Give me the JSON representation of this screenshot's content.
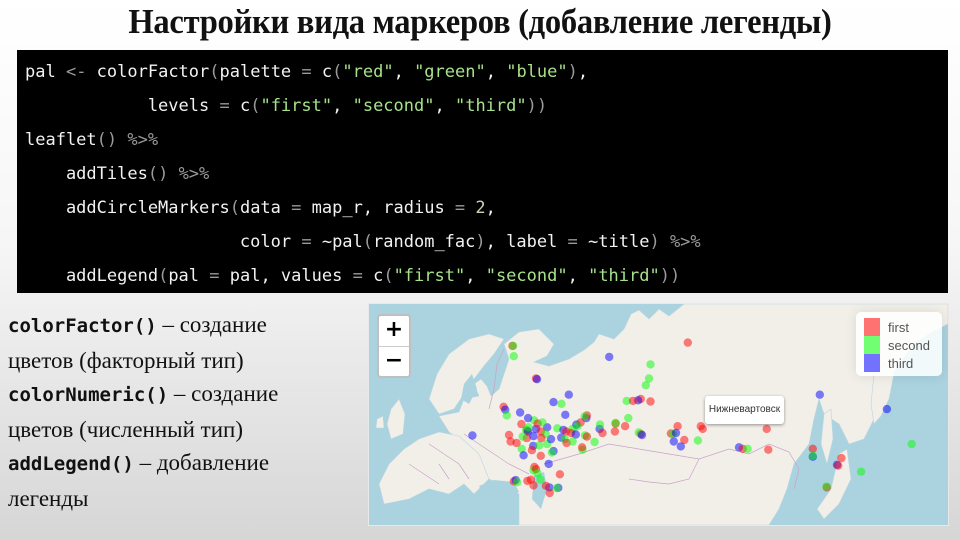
{
  "slide": {
    "title": "Настройки вида маркеров (добавление легенды)"
  },
  "code": {
    "lines": [
      [
        {
          "t": "pal ",
          "c": "plain"
        },
        {
          "t": "<-",
          "c": "op"
        },
        {
          "t": " colorFactor",
          "c": "plain"
        },
        {
          "t": "(",
          "c": "op"
        },
        {
          "t": "palette ",
          "c": "plain"
        },
        {
          "t": "=",
          "c": "op"
        },
        {
          "t": " c",
          "c": "plain"
        },
        {
          "t": "(",
          "c": "op"
        },
        {
          "t": "\"red\"",
          "c": "str"
        },
        {
          "t": ", ",
          "c": "plain"
        },
        {
          "t": "\"green\"",
          "c": "str"
        },
        {
          "t": ", ",
          "c": "plain"
        },
        {
          "t": "\"blue\"",
          "c": "str"
        },
        {
          "t": ")",
          "c": "op"
        },
        {
          "t": ",",
          "c": "plain"
        }
      ],
      [
        {
          "t": "            levels ",
          "c": "plain"
        },
        {
          "t": "=",
          "c": "op"
        },
        {
          "t": " c",
          "c": "plain"
        },
        {
          "t": "(",
          "c": "op"
        },
        {
          "t": "\"first\"",
          "c": "str"
        },
        {
          "t": ", ",
          "c": "plain"
        },
        {
          "t": "\"second\"",
          "c": "str"
        },
        {
          "t": ", ",
          "c": "plain"
        },
        {
          "t": "\"third\"",
          "c": "str"
        },
        {
          "t": "))",
          "c": "op"
        }
      ],
      [
        {
          "t": "leaflet",
          "c": "plain"
        },
        {
          "t": "()",
          "c": "op"
        },
        {
          "t": " ",
          "c": "plain"
        },
        {
          "t": "%>%",
          "c": "op"
        }
      ],
      [
        {
          "t": "    addTiles",
          "c": "plain"
        },
        {
          "t": "()",
          "c": "op"
        },
        {
          "t": " ",
          "c": "plain"
        },
        {
          "t": "%>%",
          "c": "op"
        }
      ],
      [
        {
          "t": "    addCircleMarkers",
          "c": "plain"
        },
        {
          "t": "(",
          "c": "op"
        },
        {
          "t": "data ",
          "c": "plain"
        },
        {
          "t": "=",
          "c": "op"
        },
        {
          "t": " map_r, radius ",
          "c": "plain"
        },
        {
          "t": "=",
          "c": "op"
        },
        {
          "t": " ",
          "c": "plain"
        },
        {
          "t": "2",
          "c": "num"
        },
        {
          "t": ",",
          "c": "plain"
        }
      ],
      [
        {
          "t": "                     color ",
          "c": "plain"
        },
        {
          "t": "=",
          "c": "op"
        },
        {
          "t": " ~pal",
          "c": "plain"
        },
        {
          "t": "(",
          "c": "op"
        },
        {
          "t": "random_fac",
          "c": "plain"
        },
        {
          "t": ")",
          "c": "op"
        },
        {
          "t": ", label ",
          "c": "plain"
        },
        {
          "t": "=",
          "c": "op"
        },
        {
          "t": " ~title",
          "c": "plain"
        },
        {
          "t": ")",
          "c": "op"
        },
        {
          "t": " ",
          "c": "plain"
        },
        {
          "t": "%>%",
          "c": "op"
        }
      ],
      [
        {
          "t": "    addLegend",
          "c": "plain"
        },
        {
          "t": "(",
          "c": "op"
        },
        {
          "t": "pal ",
          "c": "plain"
        },
        {
          "t": "=",
          "c": "op"
        },
        {
          "t": " pal, values ",
          "c": "plain"
        },
        {
          "t": "=",
          "c": "op"
        },
        {
          "t": " c",
          "c": "plain"
        },
        {
          "t": "(",
          "c": "op"
        },
        {
          "t": "\"first\"",
          "c": "str"
        },
        {
          "t": ", ",
          "c": "plain"
        },
        {
          "t": "\"second\"",
          "c": "str"
        },
        {
          "t": ", ",
          "c": "plain"
        },
        {
          "t": "\"third\"",
          "c": "str"
        },
        {
          "t": "))",
          "c": "op"
        }
      ]
    ]
  },
  "notes": [
    {
      "fn": "colorFactor()",
      "desc_1": " – создание",
      "desc_2": "цветов (факторный тип)"
    },
    {
      "fn": "colorNumeric()",
      "desc_1": " – создание",
      "desc_2": "цветов (численный тип)"
    },
    {
      "fn": "addLegend()",
      "desc_1": " – добавление",
      "desc_2": "легенды"
    }
  ],
  "map": {
    "zoom_in_label": "+",
    "zoom_out_label": "−",
    "tooltip_label": "Нижневартовск",
    "legend": [
      {
        "label": "first",
        "color": "#ff0000"
      },
      {
        "label": "second",
        "color": "#00ff00"
      },
      {
        "label": "third",
        "color": "#0000ff"
      }
    ],
    "colors": {
      "water": "#aad3df",
      "land": "#f2efe9",
      "border": "#c7a3c7"
    },
    "markers": [
      {
        "lat": 68.9,
        "lon": 33.1,
        "g": "first"
      },
      {
        "lat": 68.9,
        "lon": 33.3,
        "g": "second"
      },
      {
        "lat": 67.6,
        "lon": 33.5,
        "g": "second"
      },
      {
        "lat": 64.5,
        "lon": 40.5,
        "g": "first"
      },
      {
        "lat": 64.4,
        "lon": 40.8,
        "g": "third"
      },
      {
        "lat": 69.3,
        "lon": 88.2,
        "g": "first"
      },
      {
        "lat": 67.5,
        "lon": 63.5,
        "g": "third"
      },
      {
        "lat": 66.5,
        "lon": 76.5,
        "g": "second"
      },
      {
        "lat": 64.5,
        "lon": 76.0,
        "g": "second"
      },
      {
        "lat": 63.5,
        "lon": 75.0,
        "g": "second"
      },
      {
        "lat": 61.0,
        "lon": 69.0,
        "g": "second"
      },
      {
        "lat": 62.0,
        "lon": 50.8,
        "g": "third"
      },
      {
        "lat": 60.0,
        "lon": 30.3,
        "g": "first"
      },
      {
        "lat": 59.5,
        "lon": 30.8,
        "g": "third"
      },
      {
        "lat": 58.5,
        "lon": 31.3,
        "g": "second"
      },
      {
        "lat": 59.0,
        "lon": 35.5,
        "g": "third"
      },
      {
        "lat": 60.8,
        "lon": 46.0,
        "g": "third"
      },
      {
        "lat": 60.5,
        "lon": 48.5,
        "g": "second"
      },
      {
        "lat": 61.3,
        "lon": 73.4,
        "g": "first"
      },
      {
        "lat": 61.1,
        "lon": 72.6,
        "g": "third"
      },
      {
        "lat": 61.0,
        "lon": 71.0,
        "g": "first"
      },
      {
        "lat": 60.9,
        "lon": 76.5,
        "g": "first"
      },
      {
        "lat": 58.0,
        "lon": 56.3,
        "g": "third"
      },
      {
        "lat": 58.5,
        "lon": 56.5,
        "g": "first"
      },
      {
        "lat": 58.3,
        "lon": 55.8,
        "g": "second"
      },
      {
        "lat": 57.0,
        "lon": 65.5,
        "g": "first"
      },
      {
        "lat": 56.5,
        "lon": 68.5,
        "g": "first"
      },
      {
        "lat": 58.0,
        "lon": 69.5,
        "g": "second"
      },
      {
        "lat": 56.0,
        "lon": 60.5,
        "g": "third"
      },
      {
        "lat": 55.0,
        "lon": 73.4,
        "g": "first"
      },
      {
        "lat": 55.3,
        "lon": 72.8,
        "g": "second"
      },
      {
        "lat": 54.8,
        "lon": 73.8,
        "g": "third"
      },
      {
        "lat": 55.1,
        "lon": 82.9,
        "g": "first"
      },
      {
        "lat": 55.0,
        "lon": 83.5,
        "g": "second"
      },
      {
        "lat": 55.2,
        "lon": 84.5,
        "g": "third"
      },
      {
        "lat": 56.5,
        "lon": 85.0,
        "g": "first"
      },
      {
        "lat": 56.0,
        "lon": 92.9,
        "g": "first"
      },
      {
        "lat": 56.5,
        "lon": 92.3,
        "g": "first"
      },
      {
        "lat": 53.5,
        "lon": 83.8,
        "g": "third"
      },
      {
        "lat": 52.5,
        "lon": 86.0,
        "g": "third"
      },
      {
        "lat": 53.8,
        "lon": 87.1,
        "g": "first"
      },
      {
        "lat": 52.3,
        "lon": 104.3,
        "g": "third"
      },
      {
        "lat": 52.0,
        "lon": 105.5,
        "g": "first"
      },
      {
        "lat": 52.0,
        "lon": 107.0,
        "g": "second"
      },
      {
        "lat": 51.8,
        "lon": 113.5,
        "g": "first"
      },
      {
        "lat": 56.0,
        "lon": 113.0,
        "g": "first"
      },
      {
        "lat": 52.0,
        "lon": 127.5,
        "g": "first"
      },
      {
        "lat": 50.3,
        "lon": 127.5,
        "g": "third"
      },
      {
        "lat": 50.5,
        "lon": 127.5,
        "g": "second"
      },
      {
        "lat": 50.0,
        "lon": 136.5,
        "g": "first"
      },
      {
        "lat": 48.5,
        "lon": 135.1,
        "g": "third"
      },
      {
        "lat": 48.3,
        "lon": 135.5,
        "g": "first"
      },
      {
        "lat": 43.1,
        "lon": 131.9,
        "g": "first"
      },
      {
        "lat": 43.3,
        "lon": 131.8,
        "g": "second"
      },
      {
        "lat": 46.9,
        "lon": 142.7,
        "g": "second"
      },
      {
        "lat": 53.0,
        "lon": 158.6,
        "g": "second"
      },
      {
        "lat": 59.6,
        "lon": 150.8,
        "g": "third"
      },
      {
        "lat": 62.0,
        "lon": 129.7,
        "g": "third"
      },
      {
        "lat": 54.7,
        "lon": 20.5,
        "g": "third"
      },
      {
        "lat": 56.3,
        "lon": 44.0,
        "g": "third"
      },
      {
        "lat": 56.0,
        "lon": 40.5,
        "g": "third"
      },
      {
        "lat": 55.7,
        "lon": 37.6,
        "g": "first"
      },
      {
        "lat": 55.8,
        "lon": 37.4,
        "g": "second"
      },
      {
        "lat": 55.5,
        "lon": 38.0,
        "g": "third"
      },
      {
        "lat": 56.1,
        "lon": 47.2,
        "g": "second"
      },
      {
        "lat": 55.8,
        "lon": 49.1,
        "g": "third"
      },
      {
        "lat": 55.5,
        "lon": 50.0,
        "g": "first"
      },
      {
        "lat": 56.0,
        "lon": 52.0,
        "g": "second"
      },
      {
        "lat": 54.7,
        "lon": 55.9,
        "g": "second"
      },
      {
        "lat": 54.5,
        "lon": 56.5,
        "g": "first"
      },
      {
        "lat": 54.3,
        "lon": 48.4,
        "g": "third"
      },
      {
        "lat": 54.0,
        "lon": 49.5,
        "g": "second"
      },
      {
        "lat": 53.2,
        "lon": 50.1,
        "g": "first"
      },
      {
        "lat": 53.4,
        "lon": 58.9,
        "g": "second"
      },
      {
        "lat": 55.2,
        "lon": 61.4,
        "g": "first"
      },
      {
        "lat": 54.2,
        "lon": 37.6,
        "g": "first"
      },
      {
        "lat": 54.5,
        "lon": 36.3,
        "g": "second"
      },
      {
        "lat": 53.2,
        "lon": 34.4,
        "g": "first"
      },
      {
        "lat": 52.6,
        "lon": 39.6,
        "g": "third"
      },
      {
        "lat": 52.0,
        "lon": 36.0,
        "g": "second"
      },
      {
        "lat": 51.7,
        "lon": 39.2,
        "g": "first"
      },
      {
        "lat": 51.5,
        "lon": 46.0,
        "g": "third"
      },
      {
        "lat": 51.2,
        "lon": 45.5,
        "g": "second"
      },
      {
        "lat": 51.8,
        "lon": 55.1,
        "g": "second"
      },
      {
        "lat": 50.6,
        "lon": 36.6,
        "g": "third"
      },
      {
        "lat": 52.7,
        "lon": 41.5,
        "g": "second"
      },
      {
        "lat": 53.0,
        "lon": 44.0,
        "g": "second"
      },
      {
        "lat": 54.6,
        "lon": 39.7,
        "g": "third"
      },
      {
        "lat": 54.0,
        "lon": 45.2,
        "g": "third"
      },
      {
        "lat": 56.9,
        "lon": 35.9,
        "g": "first"
      },
      {
        "lat": 57.6,
        "lon": 39.9,
        "g": "second"
      },
      {
        "lat": 57.0,
        "lon": 41.0,
        "g": "first"
      },
      {
        "lat": 58.6,
        "lon": 49.7,
        "g": "third"
      },
      {
        "lat": 57.2,
        "lon": 42.5,
        "g": "second"
      },
      {
        "lat": 54.8,
        "lon": 32.0,
        "g": "first"
      },
      {
        "lat": 53.5,
        "lon": 32.5,
        "g": "first"
      },
      {
        "lat": 55.5,
        "lon": 42.0,
        "g": "first"
      },
      {
        "lat": 55.0,
        "lon": 43.5,
        "g": "second"
      },
      {
        "lat": 54.2,
        "lon": 42.2,
        "g": "first"
      },
      {
        "lat": 56.8,
        "lon": 53.2,
        "g": "third"
      },
      {
        "lat": 57.2,
        "lon": 54.5,
        "g": "first"
      },
      {
        "lat": 56.5,
        "lon": 53.5,
        "g": "second"
      },
      {
        "lat": 55.2,
        "lon": 51.5,
        "g": "first"
      },
      {
        "lat": 54.9,
        "lon": 53.0,
        "g": "third"
      },
      {
        "lat": 53.5,
        "lon": 52.0,
        "g": "second"
      },
      {
        "lat": 52.3,
        "lon": 55.0,
        "g": "first"
      },
      {
        "lat": 50.5,
        "lon": 42.0,
        "g": "first"
      },
      {
        "lat": 48.7,
        "lon": 44.5,
        "g": "third"
      },
      {
        "lat": 48.0,
        "lon": 40.0,
        "g": "first"
      },
      {
        "lat": 47.2,
        "lon": 39.7,
        "g": "second"
      },
      {
        "lat": 47.5,
        "lon": 40.5,
        "g": "first"
      },
      {
        "lat": 46.5,
        "lon": 41.0,
        "g": "second"
      },
      {
        "lat": 46.3,
        "lon": 48.0,
        "g": "first"
      },
      {
        "lat": 45.0,
        "lon": 38.9,
        "g": "first"
      },
      {
        "lat": 45.0,
        "lon": 41.9,
        "g": "second"
      },
      {
        "lat": 44.7,
        "lon": 37.8,
        "g": "first"
      },
      {
        "lat": 44.6,
        "lon": 33.5,
        "g": "first"
      },
      {
        "lat": 44.9,
        "lon": 34.1,
        "g": "third"
      },
      {
        "lat": 44.4,
        "lon": 34.6,
        "g": "second"
      },
      {
        "lat": 43.6,
        "lon": 39.7,
        "g": "first"
      },
      {
        "lat": 43.1,
        "lon": 44.7,
        "g": "third"
      },
      {
        "lat": 43.0,
        "lon": 47.5,
        "g": "third"
      },
      {
        "lat": 43.5,
        "lon": 43.6,
        "g": "first"
      },
      {
        "lat": 42.9,
        "lon": 47.0,
        "g": "second"
      },
      {
        "lat": 41.7,
        "lon": 44.8,
        "g": "first"
      },
      {
        "lat": 58.0,
        "lon": 38.0,
        "g": "third"
      },
      {
        "lat": 56.3,
        "lon": 38.1,
        "g": "second"
      },
      {
        "lat": 53.7,
        "lon": 91.4,
        "g": "second"
      },
      {
        "lat": 56.8,
        "lon": 60.6,
        "g": "second"
      },
      {
        "lat": 55.5,
        "lon": 65.3,
        "g": "first"
      },
      {
        "lat": 57.1,
        "lon": 65.5,
        "g": "second"
      }
    ]
  }
}
